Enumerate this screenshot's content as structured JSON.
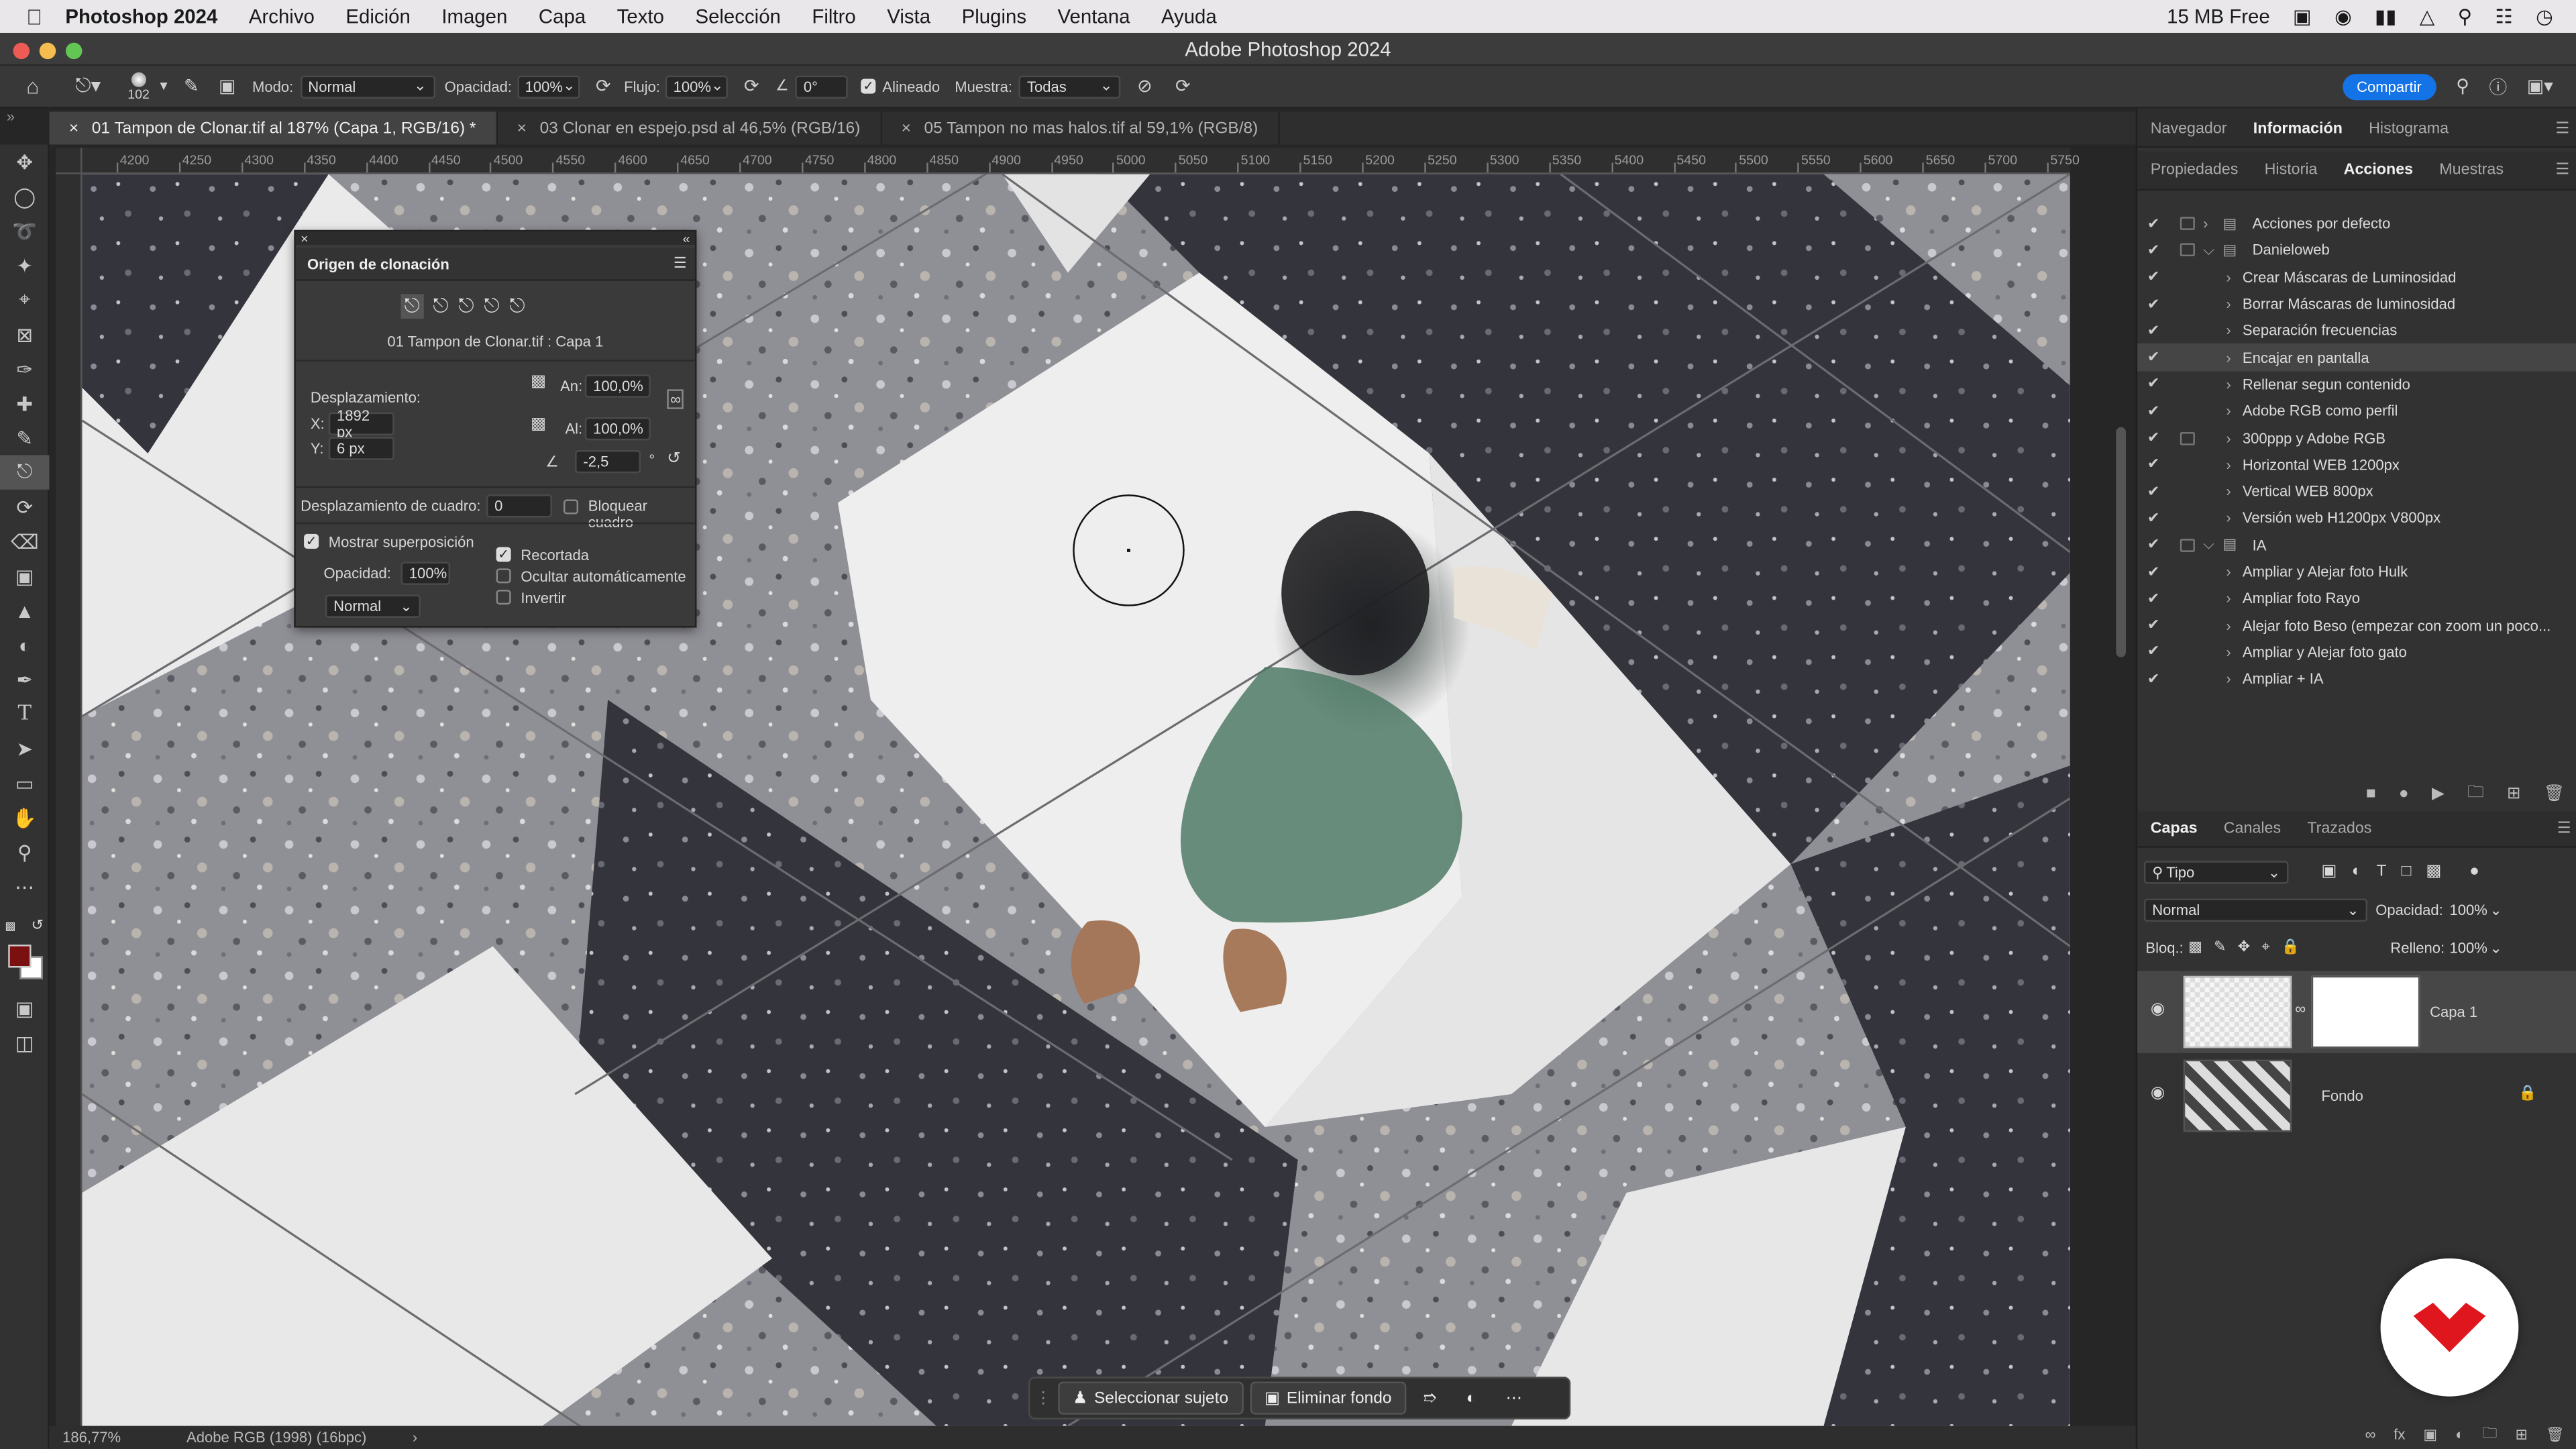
{
  "menubar": {
    "app_name": "Photoshop 2024",
    "items": [
      "Archivo",
      "Edición",
      "Imagen",
      "Capa",
      "Texto",
      "Selección",
      "Filtro",
      "Vista",
      "Plugins",
      "Ventana",
      "Ayuda"
    ],
    "status_text": "15 MB Free"
  },
  "window": {
    "title": "Adobe Photoshop 2024"
  },
  "options": {
    "brush_size": "102",
    "mode_label": "Modo:",
    "mode_value": "Normal",
    "opacity_label": "Opacidad:",
    "opacity_value": "100%",
    "flow_label": "Flujo:",
    "flow_value": "100%",
    "angle_value": "0°",
    "aligned_label": "Alineado",
    "sample_label": "Muestra:",
    "sample_value": "Todas",
    "share_label": "Compartir"
  },
  "tabs": [
    {
      "label": "01 Tampon de Clonar.tif al 187% (Capa 1, RGB/16) *"
    },
    {
      "label": "03 Clonar en espejo.psd al 46,5% (RGB/16)"
    },
    {
      "label": "05 Tampon no mas halos.tif al 59,1% (RGB/8)"
    }
  ],
  "ruler": {
    "top_ticks": [
      "4200",
      "4250",
      "4300",
      "4350",
      "4400",
      "4450",
      "4500",
      "4550",
      "4600",
      "4650",
      "4700",
      "4750",
      "4800",
      "4850",
      "4900",
      "4950",
      "5000",
      "5050",
      "5100",
      "5150",
      "5200",
      "5250",
      "5300",
      "5350",
      "5400",
      "5450",
      "5500",
      "5550",
      "5600",
      "5650",
      "5700",
      "5750"
    ]
  },
  "clone_source": {
    "title": "Origen de clonación",
    "source_name": "01 Tampon de Clonar.tif : Capa 1",
    "offset_label": "Desplazamiento:",
    "x_label": "X:",
    "x_value": "1892 px",
    "y_label": "Y:",
    "y_value": "6 px",
    "width_label": "An:",
    "width_value": "100,0%",
    "height_label": "Al:",
    "height_value": "100,0%",
    "angle_value": "-2,5",
    "angle_unit": "°",
    "frame_offset_label": "Desplazamiento de cuadro:",
    "frame_offset_value": "0",
    "lock_frame_label": "Bloquear cuadro",
    "show_overlay_label": "Mostrar superposición",
    "opacity_label": "Opacidad:",
    "opacity_value": "100%",
    "clipped_label": "Recortada",
    "auto_hide_label": "Ocultar automáticamente",
    "invert_label": "Invertir",
    "blend_value": "Normal"
  },
  "panels": {
    "top_tabs": [
      "Navegador",
      "Información",
      "Histograma"
    ],
    "mid_tabs": [
      "Propiedades",
      "Historia",
      "Acciones",
      "Muestras"
    ],
    "actions": [
      {
        "name": "Acciones por defecto",
        "type": "set",
        "expanded": false
      },
      {
        "name": "Danieloweb",
        "type": "set",
        "expanded": true
      },
      {
        "name": "Crear Máscaras de Luminosidad",
        "type": "action"
      },
      {
        "name": "Borrar Máscaras de luminosidad",
        "type": "action"
      },
      {
        "name": "Separación frecuencias",
        "type": "action"
      },
      {
        "name": "Encajar en pantalla",
        "type": "action",
        "highlight": true
      },
      {
        "name": "Rellenar segun contenido",
        "type": "action"
      },
      {
        "name": "Adobe RGB como perfil",
        "type": "action"
      },
      {
        "name": "300ppp y Adobe RGB",
        "type": "action",
        "dialog": true
      },
      {
        "name": "Horizontal WEB 1200px",
        "type": "action"
      },
      {
        "name": "Vertical WEB 800px",
        "type": "action"
      },
      {
        "name": "Versión web H1200px V800px",
        "type": "action"
      },
      {
        "name": "IA",
        "type": "set",
        "expanded": true
      },
      {
        "name": "Ampliar y Alejar foto Hulk",
        "type": "action"
      },
      {
        "name": "Ampliar foto Rayo",
        "type": "action"
      },
      {
        "name": "Alejar foto Beso (empezar con zoom un poco...",
        "type": "action"
      },
      {
        "name": "Ampliar y Alejar foto gato",
        "type": "action"
      },
      {
        "name": "Ampliar + IA",
        "type": "action"
      }
    ],
    "layer_tabs": [
      "Capas",
      "Canales",
      "Trazados"
    ],
    "layer_filter": "Tipo",
    "blend_mode": "Normal",
    "opacity_label": "Opacidad:",
    "opacity_value": "100%",
    "lock_label": "Bloq.:",
    "fill_label": "Relleno:",
    "fill_value": "100%",
    "layers": [
      {
        "name": "Capa 1"
      },
      {
        "name": "Fondo"
      }
    ]
  },
  "status": {
    "zoom": "186,77%",
    "profile": "Adobe RGB (1998) (16bpc)"
  },
  "contextual": {
    "select_subject": "Seleccionar sujeto",
    "remove_bg": "Eliminar fondo"
  },
  "colors": {
    "accent": "#1473e6",
    "foreground_swatch": "#7a1010",
    "logo_red": "#e0161f"
  }
}
